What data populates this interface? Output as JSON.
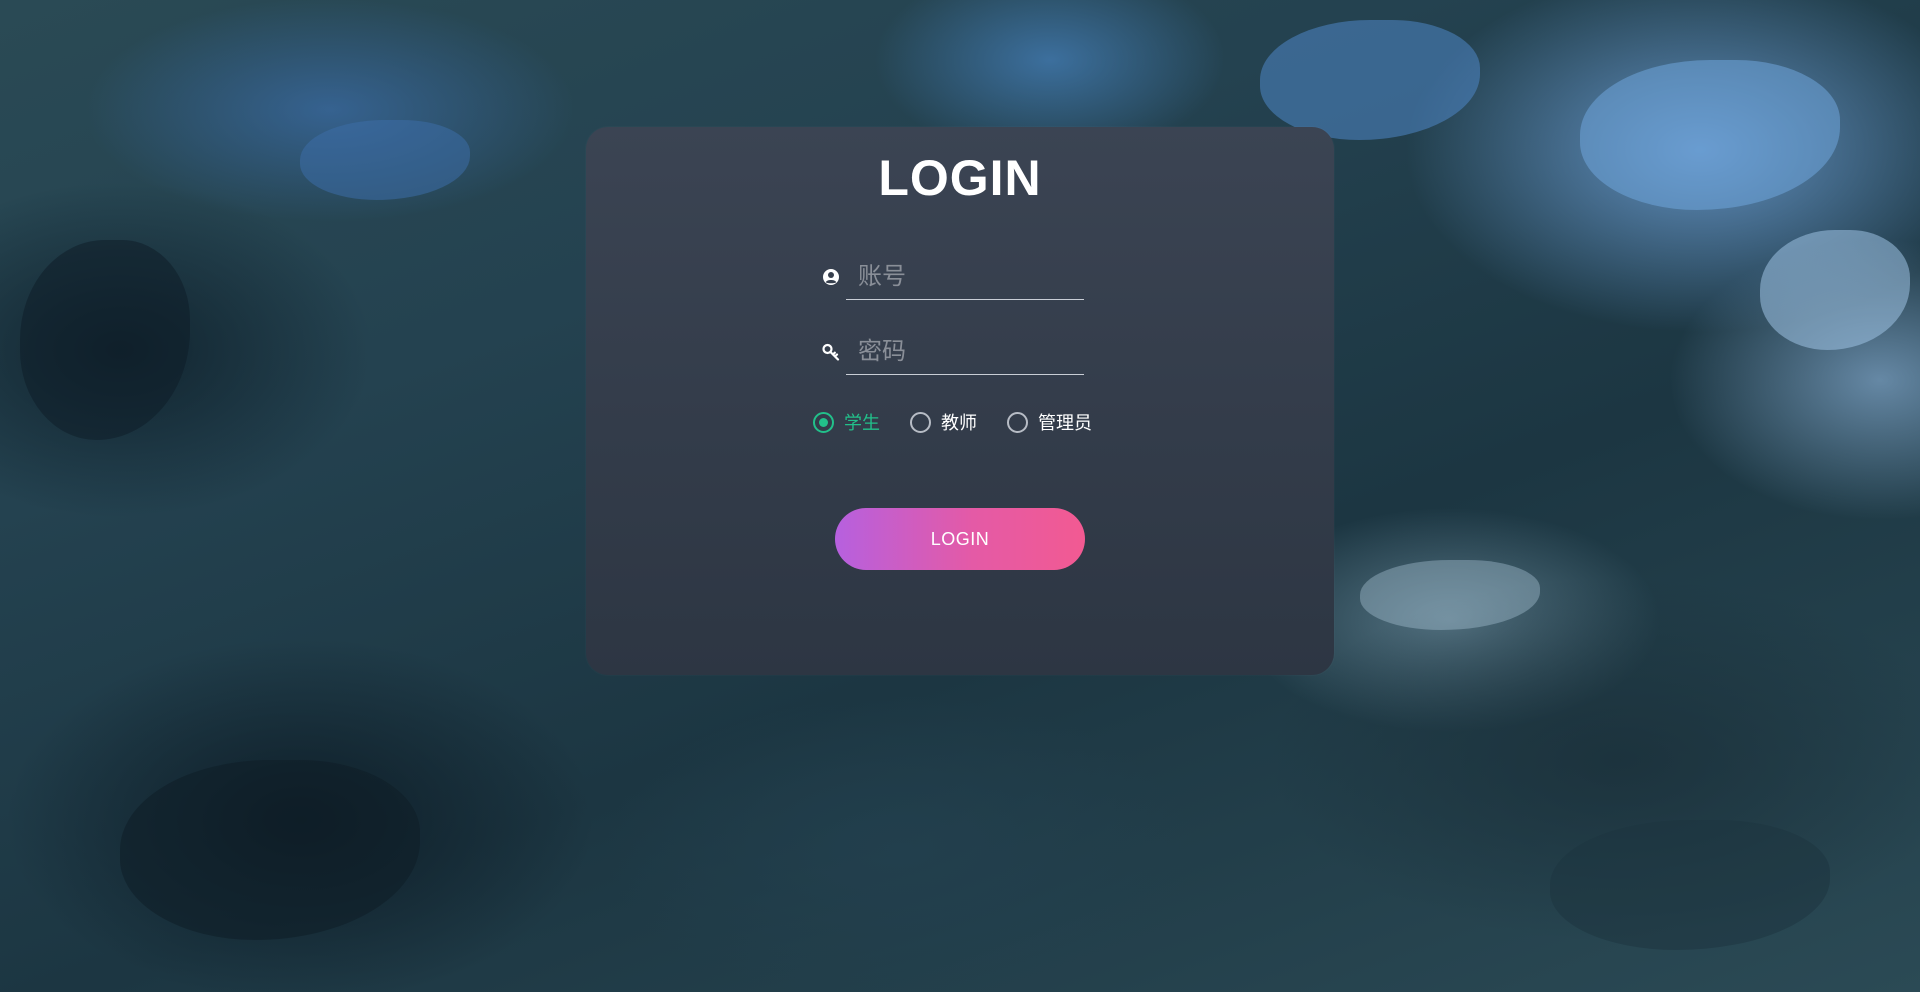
{
  "login": {
    "title": "LOGIN",
    "username": {
      "placeholder": "账号",
      "value": ""
    },
    "password": {
      "placeholder": "密码",
      "value": ""
    },
    "roles": [
      {
        "label": "学生",
        "checked": true
      },
      {
        "label": "教师",
        "checked": false
      },
      {
        "label": "管理员",
        "checked": false
      }
    ],
    "button_label": "LOGIN"
  },
  "colors": {
    "accent_green": "#22c08a",
    "button_gradient_start": "#b660df",
    "button_gradient_end": "#f25a92",
    "card_background": "#363f4d"
  },
  "icons": {
    "username": "user-circle-icon",
    "password": "key-icon"
  }
}
